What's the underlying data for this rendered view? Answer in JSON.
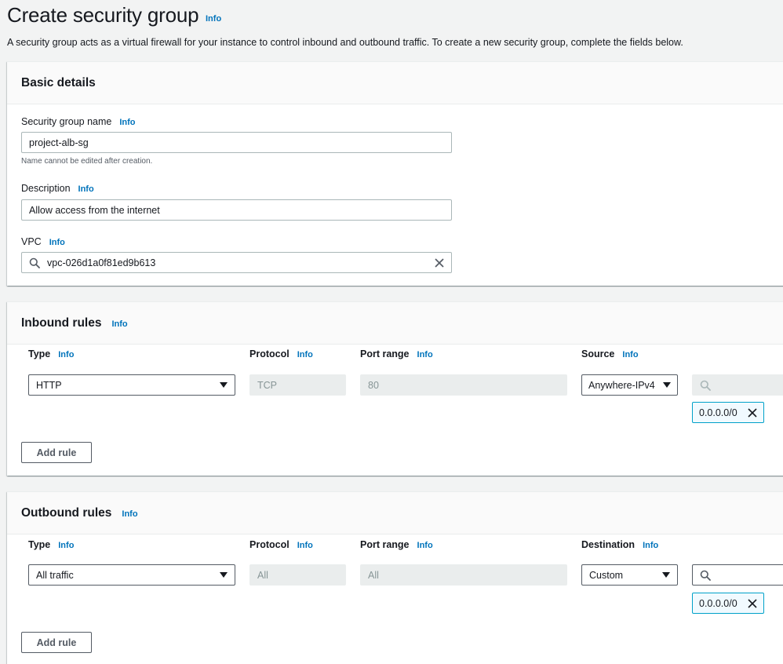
{
  "page": {
    "title": "Create security group",
    "title_info": "Info",
    "description": "A security group acts as a virtual firewall for your instance to control inbound and outbound traffic. To create a new security group, complete the fields below."
  },
  "basic_details": {
    "title": "Basic details",
    "name_label": "Security group name",
    "name_info": "Info",
    "name_value": "project-alb-sg",
    "name_hint": "Name cannot be edited after creation.",
    "description_label": "Description",
    "description_info": "Info",
    "description_value": "Allow access from the internet",
    "vpc_label": "VPC",
    "vpc_info": "Info",
    "vpc_value": "vpc-026d1a0f81ed9b613"
  },
  "inbound": {
    "title": "Inbound rules",
    "info": "Info",
    "headers": {
      "type": "Type",
      "protocol": "Protocol",
      "port_range": "Port range",
      "source": "Source",
      "info": "Info"
    },
    "rule": {
      "type": "HTTP",
      "protocol": "TCP",
      "port_range": "80",
      "source": "Anywhere-IPv4",
      "cidr": "0.0.0.0/0"
    },
    "add_rule": "Add rule"
  },
  "outbound": {
    "title": "Outbound rules",
    "info": "Info",
    "headers": {
      "type": "Type",
      "protocol": "Protocol",
      "port_range": "Port range",
      "destination": "Destination",
      "info": "Info"
    },
    "rule": {
      "type": "All traffic",
      "protocol": "All",
      "port_range": "All",
      "destination": "Custom",
      "cidr": "0.0.0.0/0"
    },
    "add_rule": "Add rule"
  },
  "colors": {
    "info_link": "#0073bb",
    "token_border": "#00a1c9",
    "token_bg": "#f1faff",
    "disabled_bg": "#eaeded"
  },
  "icons": {
    "search": "search-icon",
    "clear": "close-icon",
    "dropdown": "caret-down-icon"
  }
}
